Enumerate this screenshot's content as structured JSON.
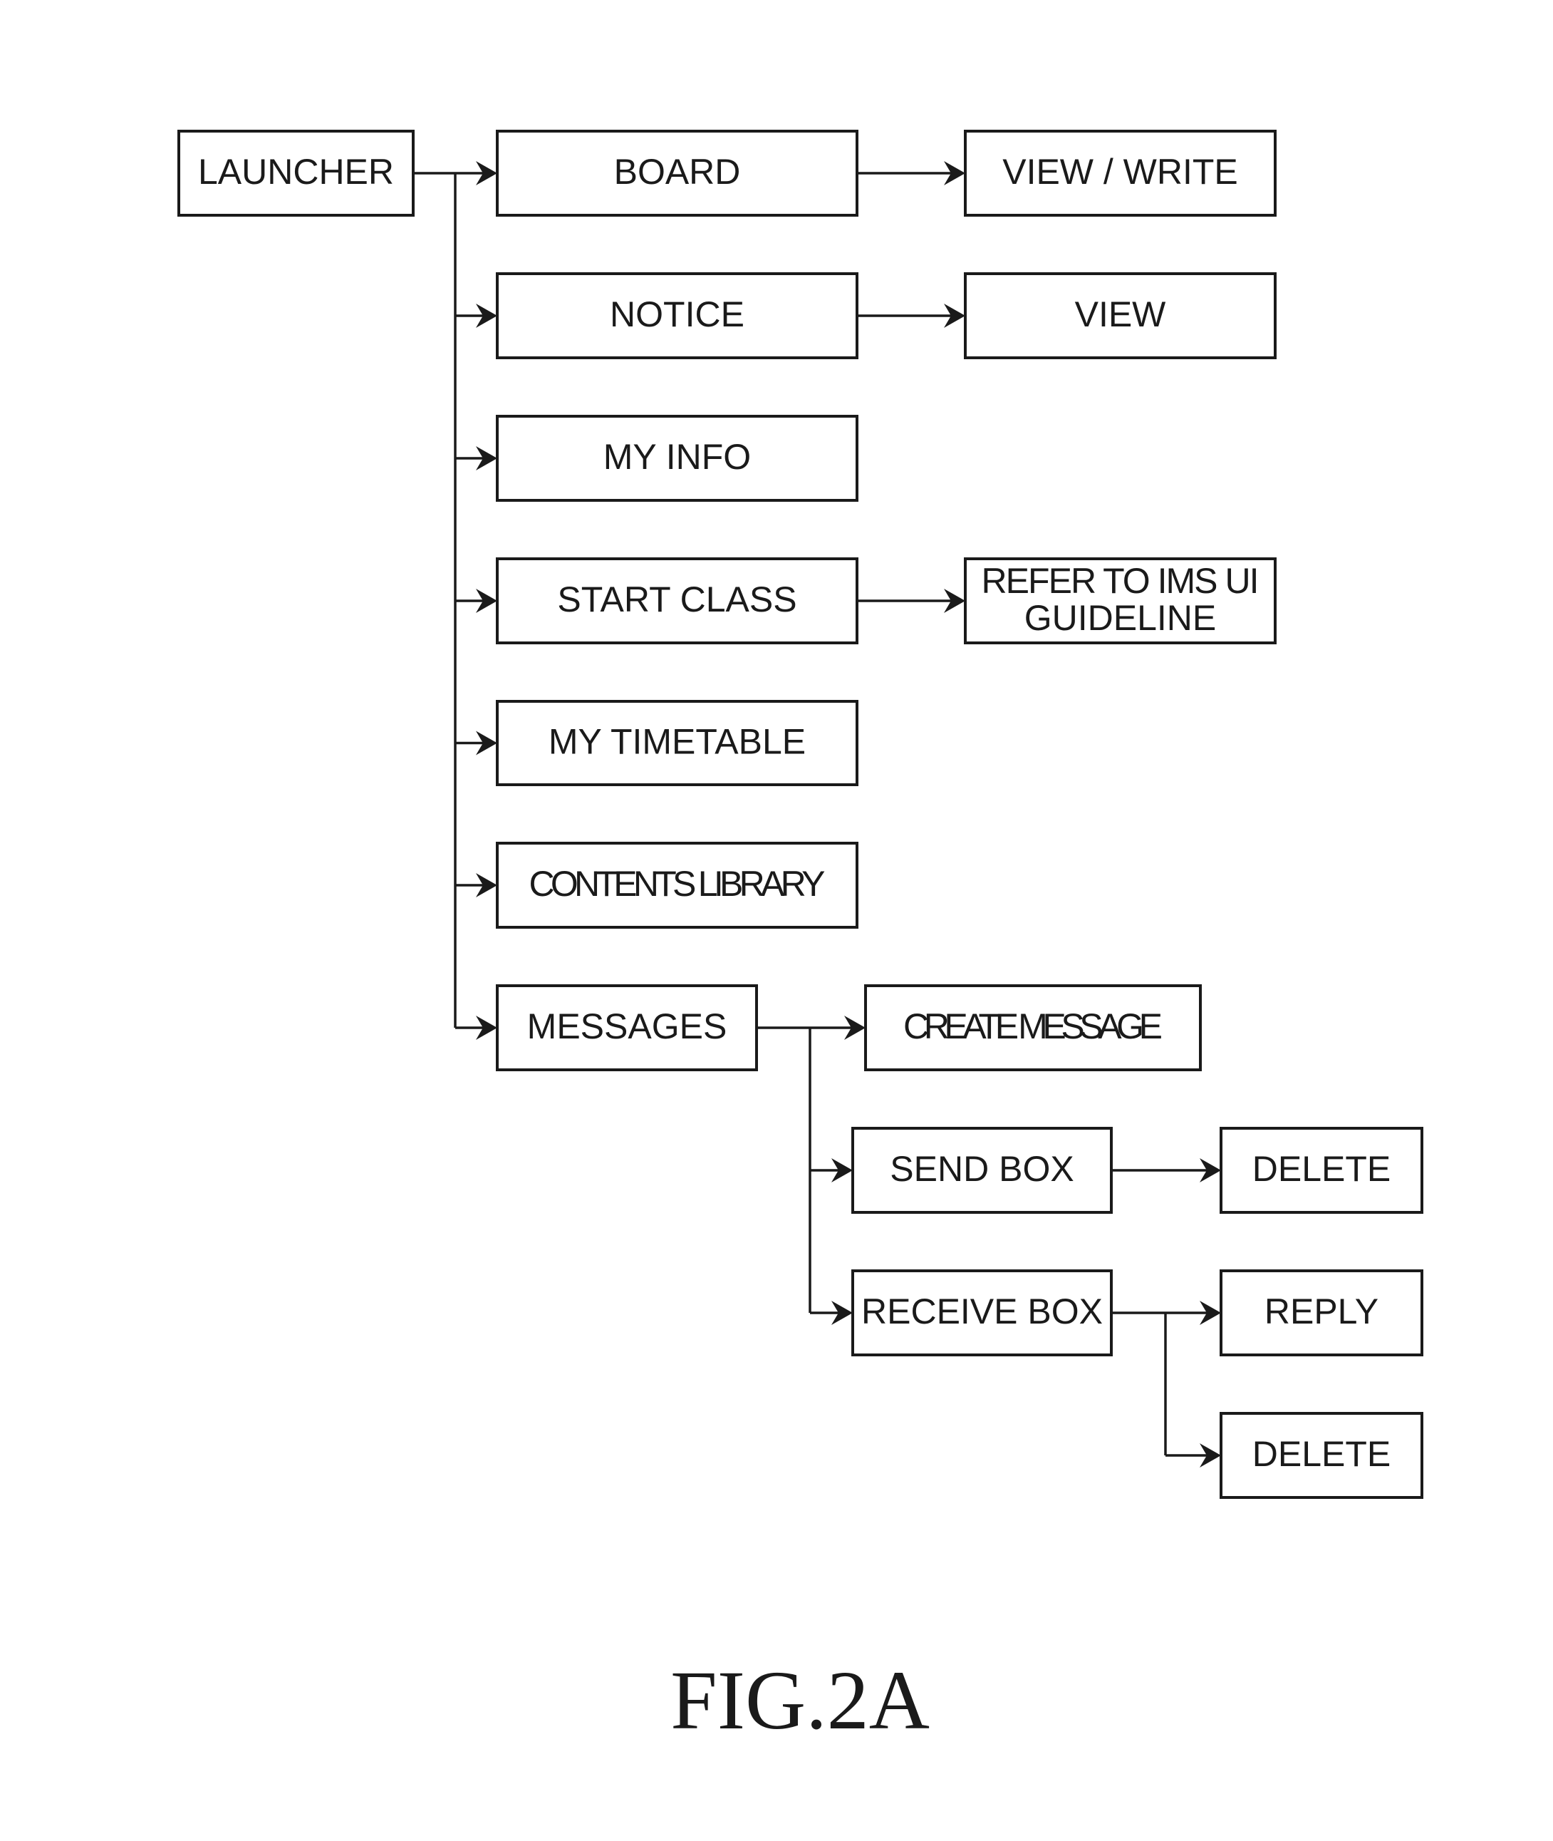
{
  "figure": {
    "caption": "FIG.2A"
  },
  "nodes": [
    {
      "id": "launcher",
      "lines": [
        "LAUNCHER"
      ]
    },
    {
      "id": "board",
      "lines": [
        "BOARD"
      ]
    },
    {
      "id": "board-view-write",
      "lines": [
        "VIEW / WRITE"
      ]
    },
    {
      "id": "notice",
      "lines": [
        "NOTICE"
      ]
    },
    {
      "id": "notice-view",
      "lines": [
        "VIEW"
      ]
    },
    {
      "id": "my-info",
      "lines": [
        "MY INFO"
      ]
    },
    {
      "id": "start-class",
      "lines": [
        "START CLASS"
      ]
    },
    {
      "id": "refer-ims",
      "lines": [
        "REFER TO IMS UI",
        "GUIDELINE"
      ]
    },
    {
      "id": "my-timetable",
      "lines": [
        "MY TIMETABLE"
      ]
    },
    {
      "id": "contents-library",
      "lines": [
        "CONTENTS LIBRARY"
      ]
    },
    {
      "id": "messages",
      "lines": [
        "MESSAGES"
      ]
    },
    {
      "id": "create-message",
      "lines": [
        "CREATE MESSAGE"
      ]
    },
    {
      "id": "send-box",
      "lines": [
        "SEND BOX"
      ]
    },
    {
      "id": "send-box-delete",
      "lines": [
        "DELETE"
      ]
    },
    {
      "id": "receive-box",
      "lines": [
        "RECEIVE BOX"
      ]
    },
    {
      "id": "receive-box-reply",
      "lines": [
        "REPLY"
      ]
    },
    {
      "id": "receive-box-delete",
      "lines": [
        "DELETE"
      ]
    }
  ],
  "edges": [
    {
      "from": "launcher",
      "to": "board"
    },
    {
      "from": "launcher",
      "to": "notice"
    },
    {
      "from": "launcher",
      "to": "my-info"
    },
    {
      "from": "launcher",
      "to": "start-class"
    },
    {
      "from": "launcher",
      "to": "my-timetable"
    },
    {
      "from": "launcher",
      "to": "contents-library"
    },
    {
      "from": "launcher",
      "to": "messages"
    },
    {
      "from": "board",
      "to": "board-view-write"
    },
    {
      "from": "notice",
      "to": "notice-view"
    },
    {
      "from": "start-class",
      "to": "refer-ims"
    },
    {
      "from": "messages",
      "to": "create-message"
    },
    {
      "from": "messages",
      "to": "send-box"
    },
    {
      "from": "messages",
      "to": "receive-box"
    },
    {
      "from": "send-box",
      "to": "send-box-delete"
    },
    {
      "from": "receive-box",
      "to": "receive-box-reply"
    },
    {
      "from": "receive-box",
      "to": "receive-box-delete"
    }
  ]
}
